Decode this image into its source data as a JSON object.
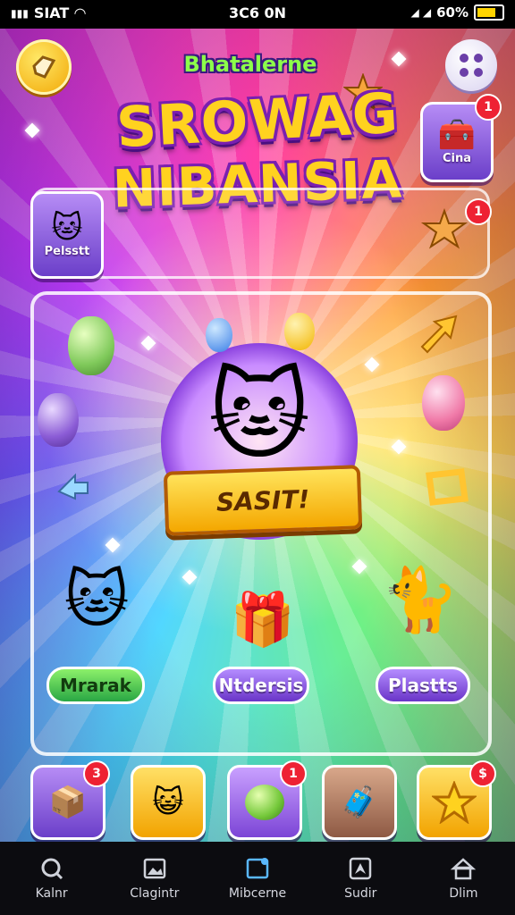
{
  "status_bar": {
    "carrier": "SIAT",
    "time": "3C6 0N",
    "battery": "60%"
  },
  "header": {
    "subtitle": "Bhatalerne",
    "title_line1": "SROWAG",
    "title_line2": "NIBANSIA"
  },
  "info_panel": {
    "left_card_label": "Pelsstt",
    "right_card_label": "Cina",
    "right_card_badge": "1",
    "starfish_badge": "1"
  },
  "board": {
    "ribbon_label": "SASIT!",
    "buttons": [
      {
        "label": "Mrarak"
      },
      {
        "label": "Ntdersis"
      },
      {
        "label": "Plastts"
      }
    ]
  },
  "slots": [
    {
      "icon": "gift-box-icon",
      "badge": "3"
    },
    {
      "icon": "cat-avatar-icon",
      "badge": ""
    },
    {
      "icon": "green-orb-icon",
      "badge": "1"
    },
    {
      "icon": "treasure-chest-icon",
      "badge": ""
    },
    {
      "icon": "star-icon",
      "badge": "$"
    }
  ],
  "tabs": [
    {
      "label": "Kalnr",
      "icon": "search-icon"
    },
    {
      "label": "Clagintr",
      "icon": "gallery-icon"
    },
    {
      "label": "Mibcerne",
      "icon": "frame-icon"
    },
    {
      "label": "Sudir",
      "icon": "compass-icon"
    },
    {
      "label": "Dlim",
      "icon": "home-icon"
    }
  ],
  "colors": {
    "accent_gold": "#ffd21f",
    "title_outline": "#7a1fb0",
    "badge_red": "#ee2233"
  }
}
